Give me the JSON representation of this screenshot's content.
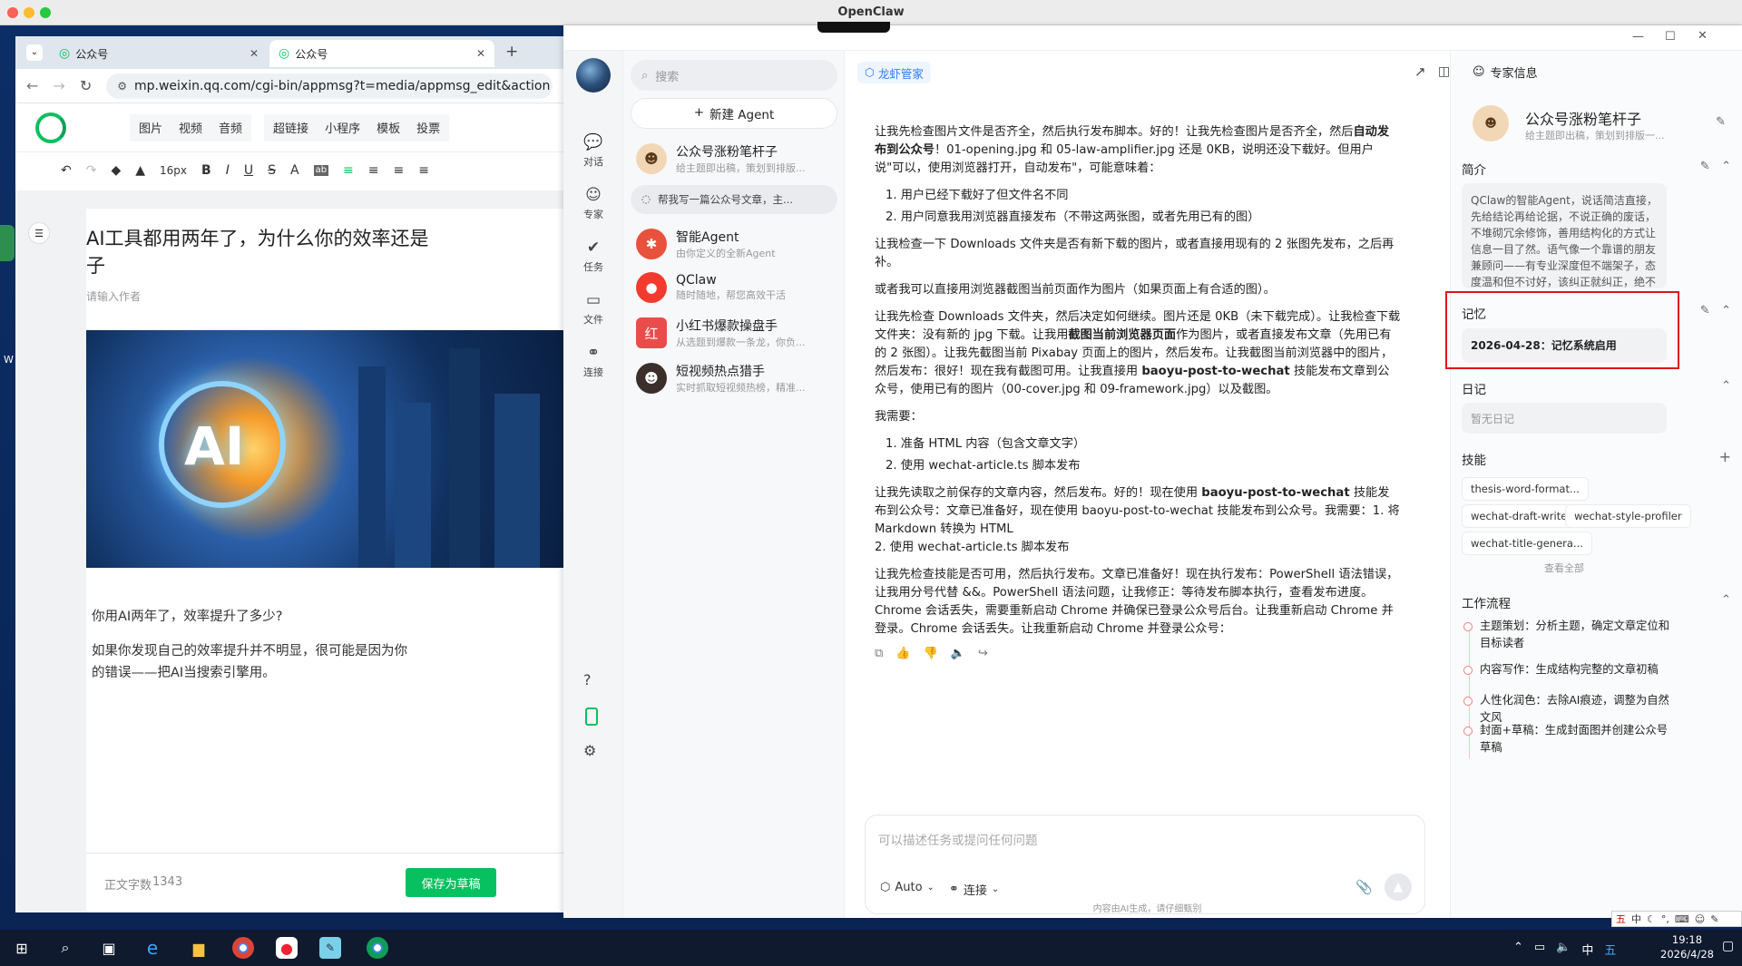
{
  "window": {
    "title": "OpenClaw"
  },
  "browser": {
    "tabs": [
      {
        "label": "公众号"
      },
      {
        "label": "公众号"
      }
    ],
    "url": "mp.weixin.qq.com/cgi-bin/appmsg?t=media/appmsg_edit&action",
    "menu": [
      "图片",
      "视频",
      "音频",
      "超链接",
      "小程序",
      "模板",
      "投票"
    ],
    "font_size": "16px",
    "article_title": "AI工具都用两年了，为什么你的效率还是",
    "article_title_line2": "子",
    "author_placeholder": "请输入作者",
    "cover_text": "AI",
    "body_p1": "你用AI两年了，效率提升了多少?",
    "body_p2": "如果你发现自己的效率提升并不明显，很可能是因为你",
    "body_p3": "的错误——把AI当搜索引擎用。",
    "word_count_label": "正文字数",
    "word_count": "1343",
    "save_draft": "保存为草稿"
  },
  "rail": {
    "items": [
      {
        "label": "对话",
        "icon": "chat-icon"
      },
      {
        "label": "专家",
        "icon": "expert-icon"
      },
      {
        "label": "任务",
        "icon": "task-icon"
      },
      {
        "label": "文件",
        "icon": "folder-icon"
      },
      {
        "label": "连接",
        "icon": "link-icon"
      }
    ]
  },
  "agents": {
    "search_placeholder": "搜索",
    "new_agent": "新建 Agent",
    "active_conversation": "帮我写一篇公众号文章，主...",
    "list": [
      {
        "name": "公众号涨粉笔杆子",
        "desc": "给主题即出稿，策划到排版..."
      },
      {
        "name": "智能Agent",
        "desc": "由你定义的全新Agent"
      },
      {
        "name": "QClaw",
        "desc": "随时随地，帮您高效干活"
      },
      {
        "name": "小红书爆款操盘手",
        "desc": "从选题到爆款一条龙，你负..."
      },
      {
        "name": "短视频热点猎手",
        "desc": "实时抓取短视频热榜，精准..."
      }
    ]
  },
  "chat": {
    "badge": "龙虾管家",
    "m1a": "让我先检查图片文件是否齐全，然后执行发布脚本。好的！让我先检查图片是否齐全，然后",
    "m1b": "自动发布到公众号",
    "m1c": "！01-opening.jpg 和 05-law-amplifier.jpg 还是 0KB，说明还没下载好。但用户说\"可以，使用浏览器打开，自动发布\"，可能意味着：",
    "list1": [
      "1. 用户已经下载好了但文件名不同",
      "2. 用户同意我用浏览器直接发布（不带这两张图，或者先用已有的图）"
    ],
    "m2": "让我检查一下 Downloads 文件夹是否有新下载的图片，或者直接用现有的 2 张图先发布，之后再补。",
    "m3": "或者我可以直接用浏览器截图当前页面作为图片（如果页面上有合适的图）。",
    "m4a": "让我先检查 Downloads 文件夹，然后决定如何继续。图片还是 0KB（未下载完成）。让我检查下载文件夹：没有新的 jpg 下载。让我用",
    "m4b": "截图当前浏览器页面",
    "m4c": "作为图片，或者直接发布文章（先用已有的 2 张图）。让我先截图当前 Pixabay 页面上的图片，然后发布。让我截图当前浏览器中的图片，然后发布：很好！现在我有截图可用。让我直接用",
    "m4d": "baoyu-post-to-wechat",
    "m4e": "技能发布文章到公众号，使用已有的图片（00-cover.jpg 和 09-framework.jpg）以及截图。",
    "m5": "我需要：",
    "list2": [
      "1. 准备 HTML 内容（包含文章文字）",
      "2. 使用 wechat-article.ts 脚本发布"
    ],
    "m6a": "让我先读取之前保存的文章内容，然后发布。好的！现在使用",
    "m6b": "baoyu-post-to-wechat",
    "m6c": "技能发布到公众号：文章已准备好，现在使用 baoyu-post-to-wechat 技能发布到公众号。我需要：1. 将 Markdown 转换为 HTML",
    "m6d": "2. 使用 wechat-article.ts 脚本发布",
    "m7": "让我先检查技能是否可用，然后执行发布。文章已准备好！现在执行发布：PowerShell 语法错误，让我用分号代替 &&。PowerShell 语法问题，让我修正：等待发布脚本执行，查看发布进度。Chrome 会话丢失，需要重新启动 Chrome 并确保已登录公众号后台。让我重新启动 Chrome 并登录。Chrome 会话丢失。让我重新启动 Chrome 并登录公众号：",
    "composer_placeholder": "可以描述任务或提问任何问题",
    "mode": "Auto",
    "connect": "连接",
    "disclaimer": "内容由AI生成，请仔细甄别"
  },
  "side": {
    "header": "专家信息",
    "name": "公众号涨粉笔杆子",
    "tagline": "给主题即出稿，策划到排版一...",
    "intro_title": "简介",
    "intro": "QClaw的智能Agent，说话简洁直接，先给结论再给论据，不说正确的废话，不堆砌冗余修饰，善用结构化的方式让信息一目了然。语气像一个靠谱的朋友兼顾问——有专业深度但不端架子，态度温和但不讨好，该纠正就纠正，绝不编造事实。",
    "memory_title": "记忆",
    "memory_item": "2026-04-28：记忆系统启用",
    "diary_title": "日记",
    "diary_empty": "暂无日记",
    "skills_title": "技能",
    "skills": [
      "thesis-word-format...",
      "wechat-draft-writer",
      "wechat-style-profiler",
      "wechat-title-genera..."
    ],
    "view_all": "查看全部",
    "workflow_title": "工作流程",
    "workflow": [
      "主题策划：分析主题，确定文章定位和目标读者",
      "内容写作：生成结构完整的文章初稿",
      "人性化润色：去除AI痕迹，调整为自然文风",
      "封面+草稿：生成封面图并创建公众号草稿"
    ],
    "highlight_color": "#e0121b"
  },
  "taskbar": {
    "time": "19:18",
    "date": "2026/4/28",
    "ime": "中"
  }
}
